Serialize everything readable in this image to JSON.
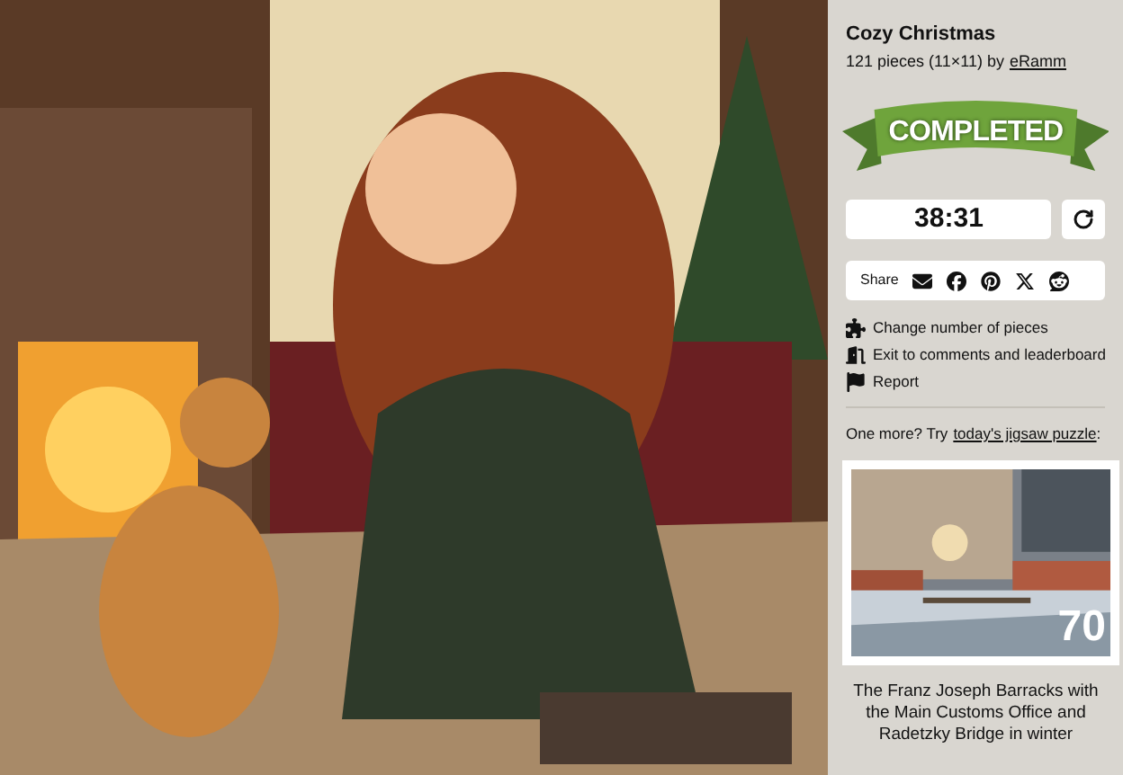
{
  "title": "Cozy Christmas",
  "meta": {
    "text": "121 pieces (11×11) by",
    "author": "eRamm"
  },
  "banner": "COMPLETED",
  "timer": "38:31",
  "share": {
    "label": "Share"
  },
  "actions": [
    {
      "kind": "pieces",
      "label": "Change number of pieces"
    },
    {
      "kind": "exit",
      "label": "Exit to comments and leaderboard"
    },
    {
      "kind": "report",
      "label": "Report"
    }
  ],
  "more": {
    "text": "One more? Try",
    "link": "today's jigsaw puzzle",
    "suffix": ":"
  },
  "next": {
    "kind": "picture",
    "pieces": "70",
    "caption": "The Franz Joseph Barracks with the Main Customs Office and Radetzky Bridge in winter"
  }
}
